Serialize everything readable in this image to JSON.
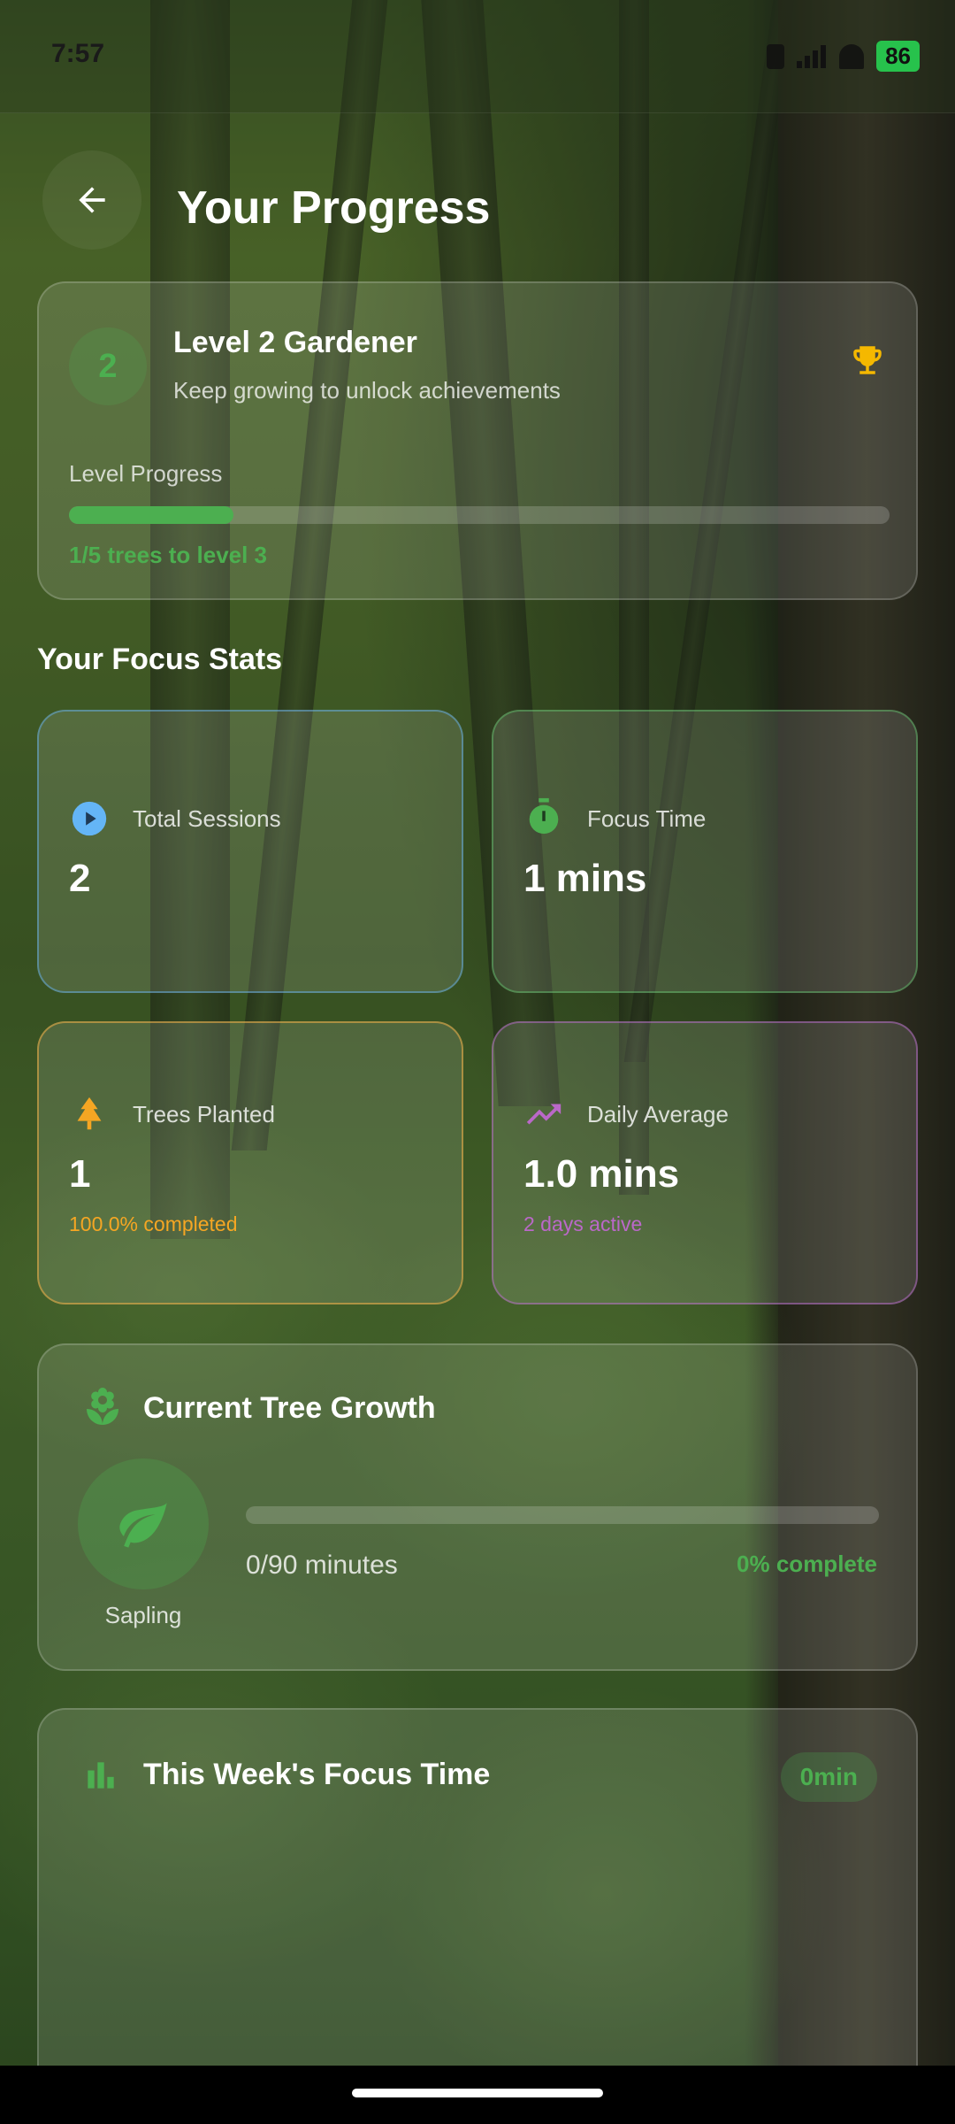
{
  "status_bar": {
    "time": "7:57",
    "battery": "86"
  },
  "header": {
    "title": "Your Progress"
  },
  "level": {
    "badge": "2",
    "title": "Level 2 Gardener",
    "subtitle": "Keep growing to unlock achievements",
    "progress_label": "Level Progress",
    "progress_fraction": 0.2,
    "caption": "1/5 trees to level 3"
  },
  "stats_section": {
    "title": "Your Focus Stats"
  },
  "stats": {
    "sessions": {
      "label": "Total Sessions",
      "value": "2",
      "icon": "play-circle-icon",
      "color": "#64b5f6"
    },
    "focus_time": {
      "label": "Focus Time",
      "value": "1 mins",
      "icon": "stopwatch-icon",
      "color": "#4caf50"
    },
    "trees": {
      "label": "Trees Planted",
      "value": "1",
      "extra": "100.0% completed",
      "icon": "tree-icon",
      "color": "#f5a623"
    },
    "daily": {
      "label": "Daily Average",
      "value": "1.0 mins",
      "extra": "2 days active",
      "icon": "trending-up-icon",
      "color": "#ba68c8"
    }
  },
  "growth": {
    "title": "Current Tree Growth",
    "stage": "Sapling",
    "minutes": "0/90 minutes",
    "percent": "0% complete",
    "progress_fraction": 0.0
  },
  "week": {
    "title": "This Week's Focus Time",
    "badge": "0min"
  },
  "colors": {
    "accent_green": "#4caf50",
    "trophy": "#f5b800"
  }
}
